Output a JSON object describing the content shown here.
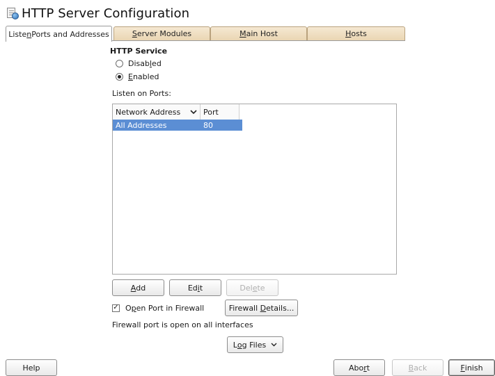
{
  "window": {
    "title": "HTTP Server Configuration",
    "icon": "http-server-config-icon"
  },
  "tabs": [
    {
      "label_pre": "Liste",
      "label_key": "n",
      "label_post": " Ports and Addresses",
      "active": true
    },
    {
      "label_pre": "",
      "label_key": "S",
      "label_post": "erver Modules",
      "active": false
    },
    {
      "label_pre": "",
      "label_key": "M",
      "label_post": "ain Host",
      "active": false
    },
    {
      "label_pre": "",
      "label_key": "H",
      "label_post": "osts",
      "active": false
    }
  ],
  "http_service": {
    "title": "HTTP Service",
    "disabled": {
      "pre": "Disab",
      "key": "l",
      "post": "ed",
      "checked": false
    },
    "enabled": {
      "pre": "",
      "key": "E",
      "post": "nabled",
      "checked": true
    }
  },
  "ports": {
    "label": "Listen on Ports:",
    "columns": {
      "address": "Network Address",
      "port": "Port",
      "sort_icon": "sort-down-icon"
    },
    "rows": [
      {
        "address": "All Addresses",
        "port": "80",
        "selected": true
      }
    ]
  },
  "table_buttons": {
    "add": {
      "pre": "",
      "key": "A",
      "post": "dd"
    },
    "edit": {
      "pre": "Ed",
      "key": "i",
      "post": "t"
    },
    "delete": {
      "pre": "Del",
      "key": "e",
      "post": "te",
      "disabled": true
    }
  },
  "firewall": {
    "checkbox": {
      "pre": "O",
      "key": "p",
      "post": "en Port in Firewall",
      "checked": true
    },
    "details_button": {
      "pre": "Firewall ",
      "key": "D",
      "post": "etails..."
    },
    "status": "Firewall port is open on all interfaces"
  },
  "log_files": {
    "pre": "L",
    "key": "o",
    "post": "g Files",
    "caret": "⌄"
  },
  "footer": {
    "help": "Help",
    "abort": {
      "pre": "Abo",
      "key": "r",
      "post": "t"
    },
    "back": {
      "pre": "",
      "key": "B",
      "post": "ack",
      "disabled": true
    },
    "finish": {
      "pre": "",
      "key": "F",
      "post": "inish"
    }
  },
  "colors": {
    "tab_inactive": "#ead6b3",
    "selection": "#5b8ed4"
  }
}
